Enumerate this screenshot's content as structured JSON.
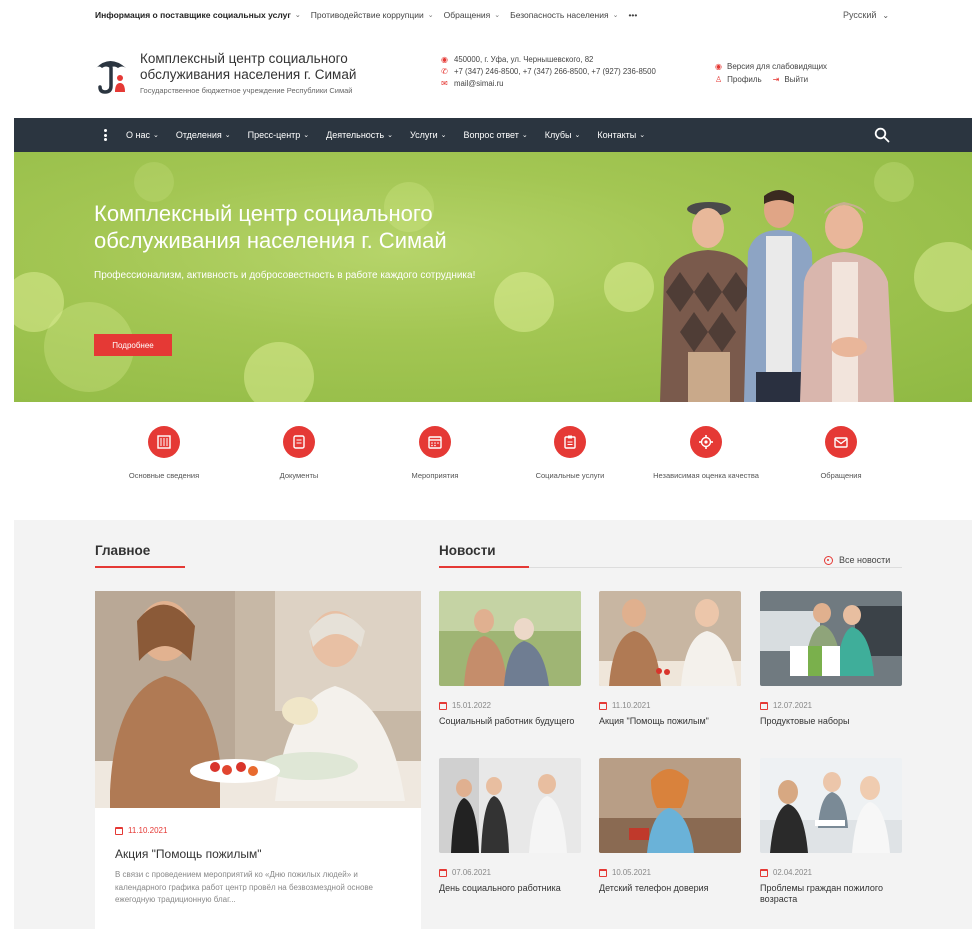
{
  "topbar": {
    "items": [
      {
        "label": "Информация о поставщике социальных услуг",
        "bold": true
      },
      {
        "label": "Противодействие коррупции"
      },
      {
        "label": "Обращения"
      },
      {
        "label": "Безопасность населения"
      },
      {
        "label": "•••"
      }
    ],
    "language": "Русский"
  },
  "header": {
    "org_name": "Комплексный центр социального обслуживания населения г. Симай",
    "org_sub": "Государственное бюджетное учреждение Республики Симай",
    "address": "450000, г. Уфа, ул. Чернышевского, 82",
    "phones": "+7 (347) 246-8500,  +7 (347) 266-8500,  +7 (927) 236-8500",
    "email": "mail@simai.ru",
    "accessibility": "Версия для слабовидящих",
    "profile": "Профиль",
    "logout": "Выйти"
  },
  "nav": {
    "items": [
      "О нас",
      "Отделения",
      "Пресс-центр",
      "Деятельность",
      "Услуги",
      "Вопрос ответ",
      "Клубы",
      "Контакты"
    ]
  },
  "hero": {
    "title": "Комплексный центр социального обслуживания населения г. Симай",
    "subtitle": "Профессионализм, активность и добросовестность в работе каждого сотрудника!",
    "button": "Подробнее"
  },
  "quick_links": [
    {
      "label": "Основные сведения",
      "icon": "building-icon"
    },
    {
      "label": "Документы",
      "icon": "document-icon"
    },
    {
      "label": "Мероприятия",
      "icon": "calendar-icon"
    },
    {
      "label": "Социальные услуги",
      "icon": "clipboard-icon"
    },
    {
      "label": "Независимая оценка качества",
      "icon": "gear-icon"
    },
    {
      "label": "Обращения",
      "icon": "envelope-icon"
    }
  ],
  "main_section": {
    "title": "Главное",
    "date": "11.10.2021",
    "headline": "Акция \"Помощь пожилым\"",
    "text": "В связи с проведением мероприятий ко «Дню пожилых людей» и календарного графика работ центр провёл на безвозмездной основе ежегодную традиционную благ..."
  },
  "news_section": {
    "title": "Новости",
    "all_news": "Все новости",
    "items": [
      {
        "date": "15.01.2022",
        "title": "Социальный работник будущего"
      },
      {
        "date": "11.10.2021",
        "title": "Акция \"Помощь пожилым\""
      },
      {
        "date": "12.07.2021",
        "title": "Продуктовые наборы"
      },
      {
        "date": "07.06.2021",
        "title": "День социального работника"
      },
      {
        "date": "10.05.2021",
        "title": "Детский телефон доверия"
      },
      {
        "date": "02.04.2021",
        "title": "Проблемы граждан пожилого возраста"
      }
    ]
  },
  "colors": {
    "accent": "#e53935",
    "nav_bg": "#2b3540",
    "hero_green": "#a3c653"
  }
}
